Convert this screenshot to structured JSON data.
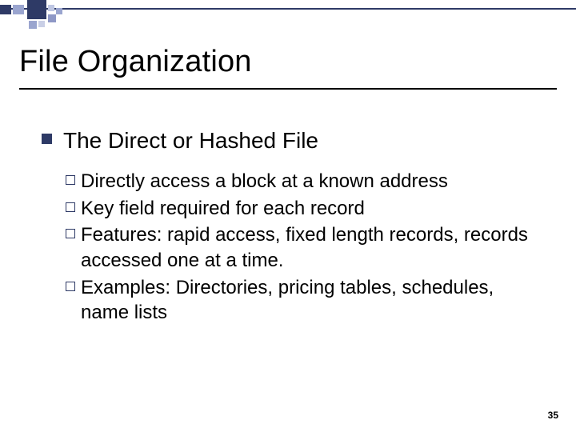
{
  "slide": {
    "title": "File Organization",
    "page_number": "35"
  },
  "body": {
    "heading": "The Direct or Hashed File",
    "items": [
      "Directly access a block at a known address",
      "Key field required for each record",
      "Features: rapid access, fixed length records, records accessed one at a time.",
      "Examples: Directories, pricing tables, schedules, name lists"
    ]
  }
}
